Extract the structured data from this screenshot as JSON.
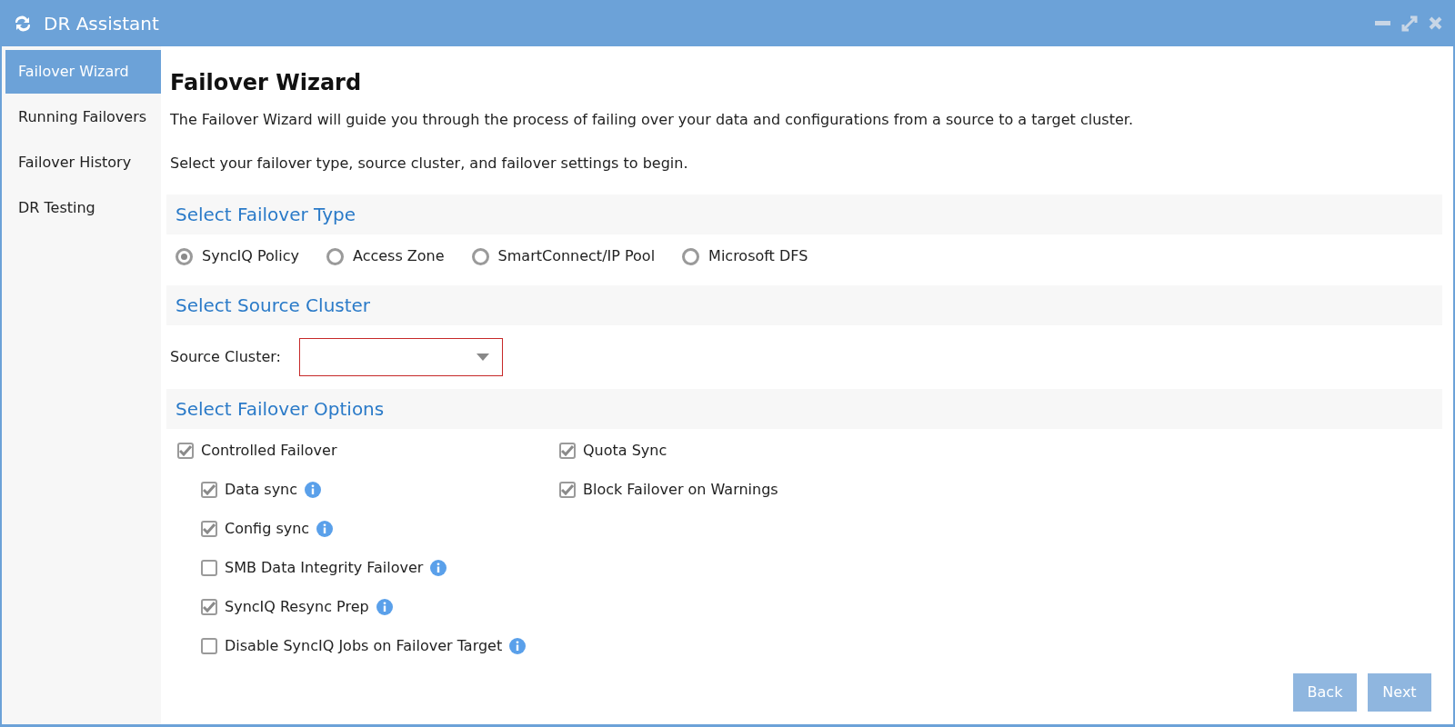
{
  "window": {
    "title": "DR Assistant"
  },
  "sidebar": {
    "items": [
      {
        "label": "Failover Wizard",
        "selected": true
      },
      {
        "label": "Running Failovers",
        "selected": false
      },
      {
        "label": "Failover History",
        "selected": false
      },
      {
        "label": "DR Testing",
        "selected": false
      }
    ]
  },
  "heading": "Failover Wizard",
  "intro": [
    "The Failover Wizard will guide you through the process of failing over your data and configurations from a source to a target cluster.",
    "Select your failover type, source cluster, and failover settings to begin."
  ],
  "failover_type": {
    "title": "Select Failover Type",
    "options": [
      {
        "label": "SyncIQ Policy",
        "selected": true
      },
      {
        "label": "Access Zone",
        "selected": false
      },
      {
        "label": "SmartConnect/IP Pool",
        "selected": false
      },
      {
        "label": "Microsoft DFS",
        "selected": false
      }
    ]
  },
  "source_cluster": {
    "title": "Select Source Cluster",
    "label": "Source Cluster:",
    "invalid": true
  },
  "failover_options": {
    "title": "Select Failover Options",
    "columns": [
      [
        {
          "label": "Controlled Failover",
          "checked": true,
          "info": false,
          "children": [
            {
              "label": "Data sync",
              "checked": true,
              "info": true
            },
            {
              "label": "Config sync",
              "checked": true,
              "info": true
            },
            {
              "label": "SMB Data Integrity Failover",
              "checked": false,
              "info": true
            },
            {
              "label": "SyncIQ Resync Prep",
              "checked": true,
              "info": true
            },
            {
              "label": "Disable SyncIQ Jobs on Failover Target",
              "checked": false,
              "info": true
            }
          ]
        }
      ],
      [
        {
          "label": "Quota Sync",
          "checked": true,
          "info": false
        },
        {
          "label": "Block Failover on Warnings",
          "checked": true,
          "info": false
        }
      ]
    ]
  },
  "buttons": [
    {
      "label": "Back",
      "disabled": true
    },
    {
      "label": "Next",
      "disabled": true
    }
  ]
}
